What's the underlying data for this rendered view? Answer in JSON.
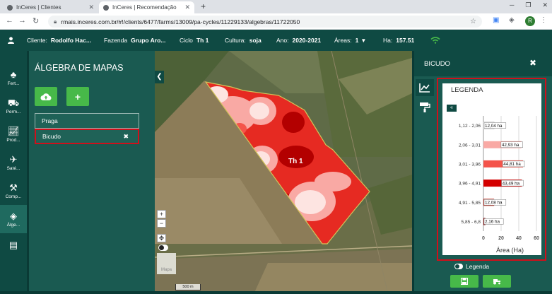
{
  "browser": {
    "tabs": [
      {
        "title": "InCeres | Clientes"
      },
      {
        "title": "InCeres | Recomendação"
      }
    ],
    "url": "rmais.inceres.com.br/#!/clients/6477/farms/13009/pa-cycles/11229133/algebras/11722050",
    "profile_initial": "R"
  },
  "header": {
    "cliente_label": "Cliente:",
    "cliente_value": "Rodolfo Hac...",
    "fazenda_label": "Fazenda",
    "fazenda_value": "Grupo Aro...",
    "ciclo_label": "Ciclo",
    "ciclo_value": "Th 1",
    "cultura_label": "Cultura:",
    "cultura_value": "soja",
    "ano_label": "Ano:",
    "ano_value": "2020-2021",
    "areas_label": "Áreas:",
    "areas_value": "1",
    "ha_label": "Ha:",
    "ha_value": "157.51"
  },
  "rail": {
    "items": [
      {
        "label": "Fert...",
        "icon": "fertility-icon"
      },
      {
        "label": "Perm...",
        "icon": "tractor-icon"
      },
      {
        "label": "Prod...",
        "icon": "chart-line-icon"
      },
      {
        "label": "Saté...",
        "icon": "satellite-icon"
      },
      {
        "label": "Comp...",
        "icon": "compare-icon"
      },
      {
        "label": "Álge...",
        "icon": "layers-icon"
      },
      {
        "label": "",
        "icon": "report-icon"
      }
    ]
  },
  "left_panel": {
    "title": "ÁLGEBRA DE MAPAS",
    "layers": [
      {
        "label": "Praga"
      },
      {
        "label": "Bicudo"
      }
    ]
  },
  "map": {
    "field_label": "Th 1",
    "scale_label": "500 m",
    "thumb_label": "Mapa",
    "zoom_in": "+",
    "zoom_out": "−",
    "fullscreen": "✥"
  },
  "right_panel": {
    "title": "BICUDO",
    "legend_title": "LEGENDA",
    "legend_toggle_label": "Legenda"
  },
  "chart_data": {
    "type": "bar",
    "orientation": "horizontal",
    "categories": [
      "1,12 - 2,06",
      "2,06 - 3,01",
      "3,01 - 3,96",
      "3,96 - 4,91",
      "4,91 - 5,85",
      "5,85 - 6,8"
    ],
    "values": [
      12.04,
      42.93,
      44.81,
      43.49,
      12.08,
      2.16
    ],
    "data_labels": [
      "12,04 ha",
      "42,93 ha",
      "44,81 ha",
      "43,49 ha",
      "12,08 ha",
      "2,16 ha"
    ],
    "colors": [
      "#ffffff",
      "#f9a9a4",
      "#f4544b",
      "#d40000",
      "#c42a1e",
      "#8a0000"
    ],
    "xlabel": "Área (Ha)",
    "ylabel": "",
    "xlim": [
      0,
      60
    ],
    "xticks": [
      0,
      20,
      40,
      60
    ],
    "grid": true
  },
  "colors": {
    "brand_dark": "#0f4a43",
    "brand_panel": "#1a5a51",
    "accent_green": "#47b949",
    "highlight_red": "#d0101b"
  }
}
